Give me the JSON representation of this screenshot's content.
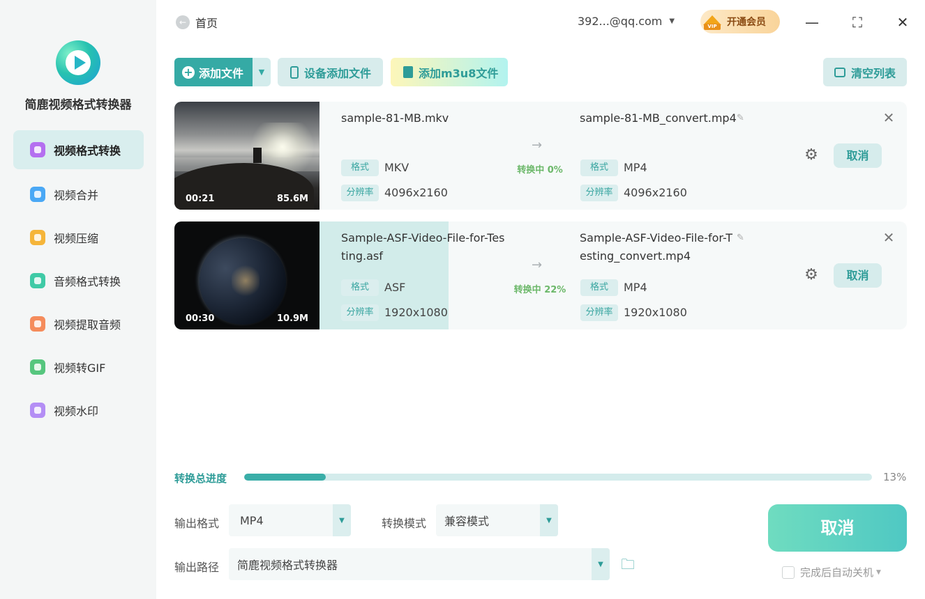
{
  "app": {
    "name": "简鹿视频格式转换器"
  },
  "sidebar": {
    "items": [
      {
        "label": "视频格式转换",
        "active": true,
        "color": "#b46ff0"
      },
      {
        "label": "视频合并",
        "active": false,
        "color": "#4aa8f5"
      },
      {
        "label": "视频压缩",
        "active": false,
        "color": "#f5b53a"
      },
      {
        "label": "音频格式转换",
        "active": false,
        "color": "#3fcaa6"
      },
      {
        "label": "视频提取音频",
        "active": false,
        "color": "#f58c5c"
      },
      {
        "label": "视频转GIF",
        "active": false,
        "color": "#56c67e"
      },
      {
        "label": "视频水印",
        "active": false,
        "color": "#b48ef5"
      }
    ]
  },
  "header": {
    "home_label": "首页",
    "account": "392...@qq.com",
    "vip_label": "开通会员",
    "vip_badge": "VIP"
  },
  "toolbar": {
    "add_file": "添加文件",
    "device_add": "设备添加文件",
    "add_m3u8": "添加m3u8文件",
    "clear_list": "清空列表"
  },
  "files": [
    {
      "duration": "00:21",
      "size": "85.6M",
      "source_name": "sample-81-MB.mkv",
      "format_tag": "格式",
      "source_format": "MKV",
      "resolution_tag": "分辨率",
      "source_resolution": "4096x2160",
      "status": "转换中 0%",
      "progress": 0,
      "output_name": "sample-81-MB_convert.mp4",
      "output_format": "MP4",
      "output_resolution": "4096x2160",
      "cancel_label": "取消"
    },
    {
      "duration": "00:30",
      "size": "10.9M",
      "source_name": "Sample-ASF-Video-File-for-Testing.asf",
      "format_tag": "格式",
      "source_format": "ASF",
      "resolution_tag": "分辨率",
      "source_resolution": "1920x1080",
      "status": "转换中 22%",
      "progress": 22,
      "output_name": "Sample-ASF-Video-File-for-Testing_convert.mp4",
      "output_format": "MP4",
      "output_resolution": "1920x1080",
      "cancel_label": "取消"
    }
  ],
  "total_progress": {
    "label": "转换总进度",
    "percent": 13,
    "percent_text": "13%"
  },
  "output": {
    "format_label": "输出格式",
    "format_value": "MP4",
    "mode_label": "转换模式",
    "mode_value": "兼容模式",
    "path_label": "输出路径",
    "path_value": "简鹿视频格式转换器"
  },
  "actions": {
    "cancel_all": "取消",
    "shutdown_label": "完成后自动关机"
  },
  "colors": {
    "accent": "#35aaa5",
    "status_green": "#6cb86a"
  }
}
